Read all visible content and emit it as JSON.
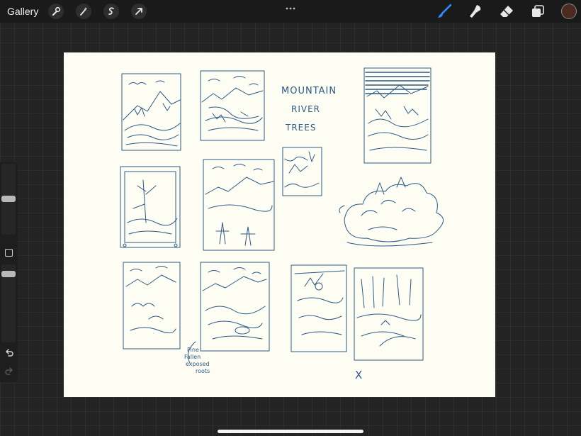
{
  "toolbar": {
    "gallery_label": "Gallery",
    "left_tools": [
      "wrench-icon",
      "magic-wand-icon",
      "selection-icon",
      "transform-arrow-icon"
    ],
    "more_icon": "ellipsis-icon",
    "right_tools": [
      "brush-icon",
      "smudge-icon",
      "eraser-icon",
      "layers-icon"
    ],
    "active_color": "#4a2b1e",
    "accent_color": "#2f8cff"
  },
  "canvas": {
    "background_color": "#fdfdf3",
    "ink_color": "#2c5a86",
    "handwritten_notes": {
      "title_line1": "MOUNTAIN",
      "title_line2": "RIVER",
      "title_line3": "TREES",
      "note_line1": "Pine",
      "note_line2": "Fallen",
      "note_line3": "exposed",
      "note_line4": "roots",
      "mark": "X"
    }
  },
  "sidebar": {
    "brush_size": 0.27,
    "opacity": 0.28,
    "undo_icon": "undo-icon",
    "redo_icon": "redo-icon",
    "modify_icon": "square-icon"
  }
}
